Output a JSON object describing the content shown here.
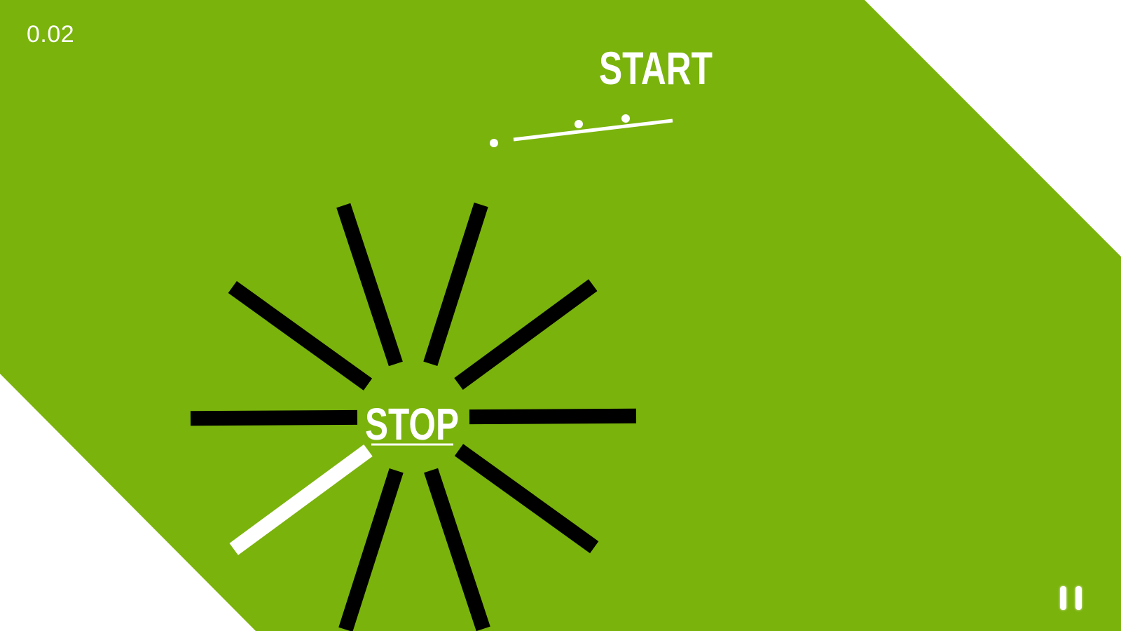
{
  "game": {
    "timer": "0.02",
    "start_label": "START",
    "stop_label": "STOP",
    "pause_icon": "pause-icon"
  },
  "colors": {
    "field": "#7ab30b",
    "background": "#ffffff",
    "spoke": "#000000",
    "active_spoke": "#ffffff",
    "text": "#ffffff"
  },
  "spokes": {
    "count": 10,
    "active_index": 7
  }
}
